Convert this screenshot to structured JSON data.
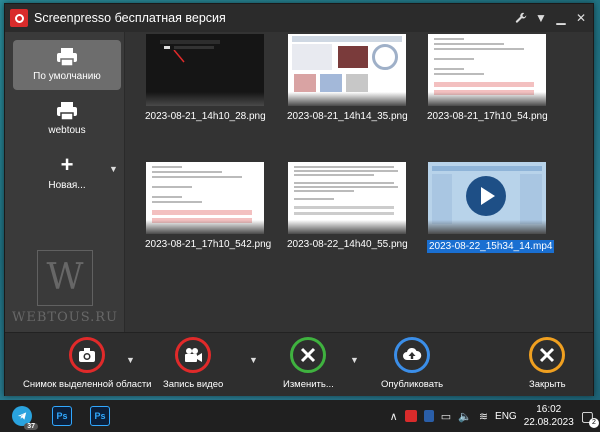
{
  "window": {
    "title": "Screenpresso бесплатная версия",
    "controls": [
      "wrench-icon",
      "dropdown-icon",
      "minimize-icon",
      "close-icon"
    ]
  },
  "sidebar": {
    "items": [
      {
        "label": "По умолчанию",
        "icon": "printer-icon",
        "active": true
      },
      {
        "label": "webtous",
        "icon": "printer-icon",
        "active": false
      },
      {
        "label": "Новая...",
        "icon": "plus-icon",
        "active": false
      }
    ],
    "watermark": {
      "letter": "W",
      "text": "WEBTOUS.RU"
    }
  },
  "gallery": {
    "items": [
      {
        "filename": "2023-08-21_14h10_28.png",
        "kind": "dark",
        "selected": false
      },
      {
        "filename": "2023-08-21_14h14_35.png",
        "kind": "web",
        "selected": false
      },
      {
        "filename": "2023-08-21_17h10_54.png",
        "kind": "doc",
        "selected": false
      },
      {
        "filename": "2023-08-21_17h10_542.png",
        "kind": "doc",
        "selected": false
      },
      {
        "filename": "2023-08-22_14h40_55.png",
        "kind": "doc",
        "selected": false
      },
      {
        "filename": "2023-08-22_15h34_14.mp4",
        "kind": "video",
        "selected": true
      }
    ]
  },
  "toolbar": {
    "capture_label": "Снимок выделенной области",
    "record_label": "Запись видео",
    "edit_label": "Изменить...",
    "publish_label": "Опубликовать",
    "close_label": "Закрыть",
    "colors": {
      "capture": "#e02a2a",
      "record": "#e02a2a",
      "edit": "#3fb23f",
      "publish": "#3b8ee8",
      "close": "#f0a020"
    }
  },
  "taskbar": {
    "apps": [
      {
        "name": "telegram-icon",
        "label": "",
        "badge": "37"
      },
      {
        "name": "photoshop-icon",
        "label": "Ps",
        "badge": ""
      },
      {
        "name": "photoshop-icon",
        "label": "Ps",
        "badge": ""
      }
    ],
    "language": "ENG",
    "time": "16:02",
    "date": "22.08.2023",
    "notifications": "2"
  }
}
